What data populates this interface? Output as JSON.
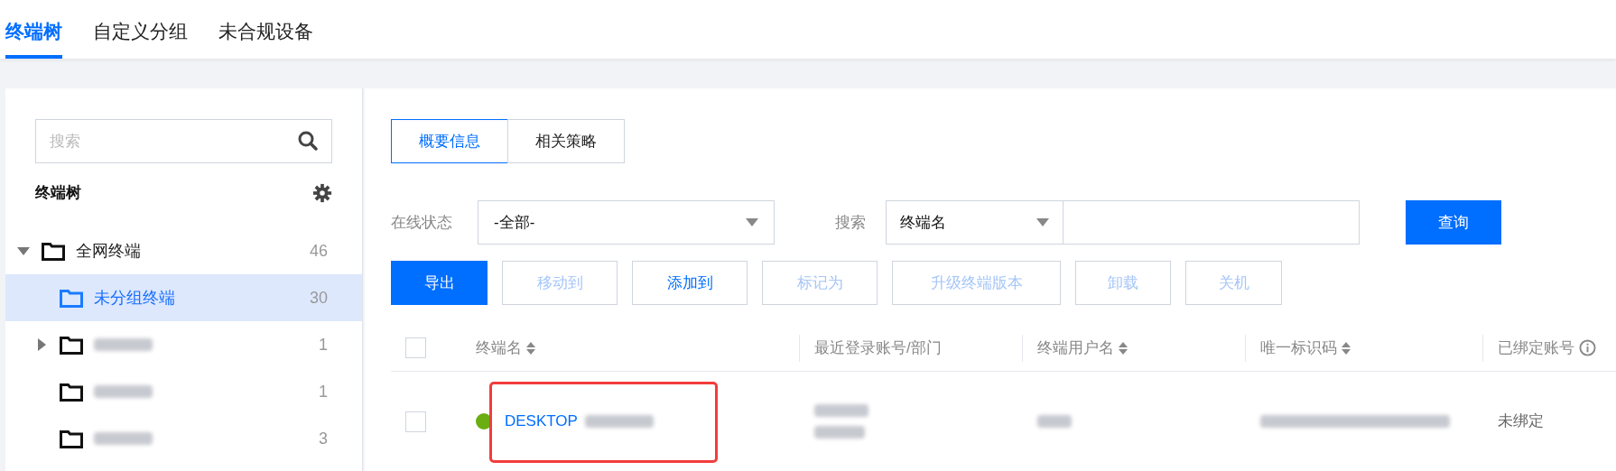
{
  "top_tabs": [
    {
      "label": "终端树",
      "selected": true
    },
    {
      "label": "自定义分组",
      "selected": false
    },
    {
      "label": "未合规设备",
      "selected": false
    }
  ],
  "sidebar": {
    "search": {
      "placeholder": "搜索"
    },
    "title": "终端树",
    "tree": [
      {
        "label": "全网终端",
        "count": "46",
        "expanded": true,
        "selected": false,
        "children": [
          {
            "label": "未分组终端",
            "count": "30",
            "selected": true
          },
          {
            "count": "1",
            "expanded": false,
            "has_children": true,
            "selected": false
          },
          {
            "count": "1",
            "has_children": false,
            "selected": false
          },
          {
            "count": "3",
            "has_children": false,
            "selected": false
          }
        ]
      }
    ]
  },
  "view_tabs": [
    {
      "label": "概要信息",
      "selected": true
    },
    {
      "label": "相关策略",
      "selected": false
    }
  ],
  "filters": {
    "status_label": "在线状态",
    "status_value": "-全部-",
    "search_label": "搜索",
    "search_field": "终端名",
    "query_button": "查询"
  },
  "actions": [
    {
      "label": "导出",
      "kind": "primary"
    },
    {
      "label": "移动到",
      "kind": "disabled"
    },
    {
      "label": "添加到",
      "kind": "normal"
    },
    {
      "label": "标记为",
      "kind": "disabled"
    },
    {
      "label": "升级终端版本",
      "kind": "disabled"
    },
    {
      "label": "卸载",
      "kind": "disabled"
    },
    {
      "label": "关机",
      "kind": "disabled"
    }
  ],
  "table": {
    "select_all_checked": false,
    "columns": [
      {
        "label": "终端名",
        "sortable": true
      },
      {
        "label": "最近登录账号/部门",
        "sortable": false
      },
      {
        "label": "终端用户名",
        "sortable": true
      },
      {
        "label": "唯一标识码",
        "sortable": true
      },
      {
        "label": "已绑定账号",
        "sortable": false,
        "info": true
      }
    ],
    "rows": [
      {
        "checked": false,
        "online": true,
        "name": "DESKTOP",
        "binding": "未绑定",
        "highlighted": true
      }
    ]
  }
}
